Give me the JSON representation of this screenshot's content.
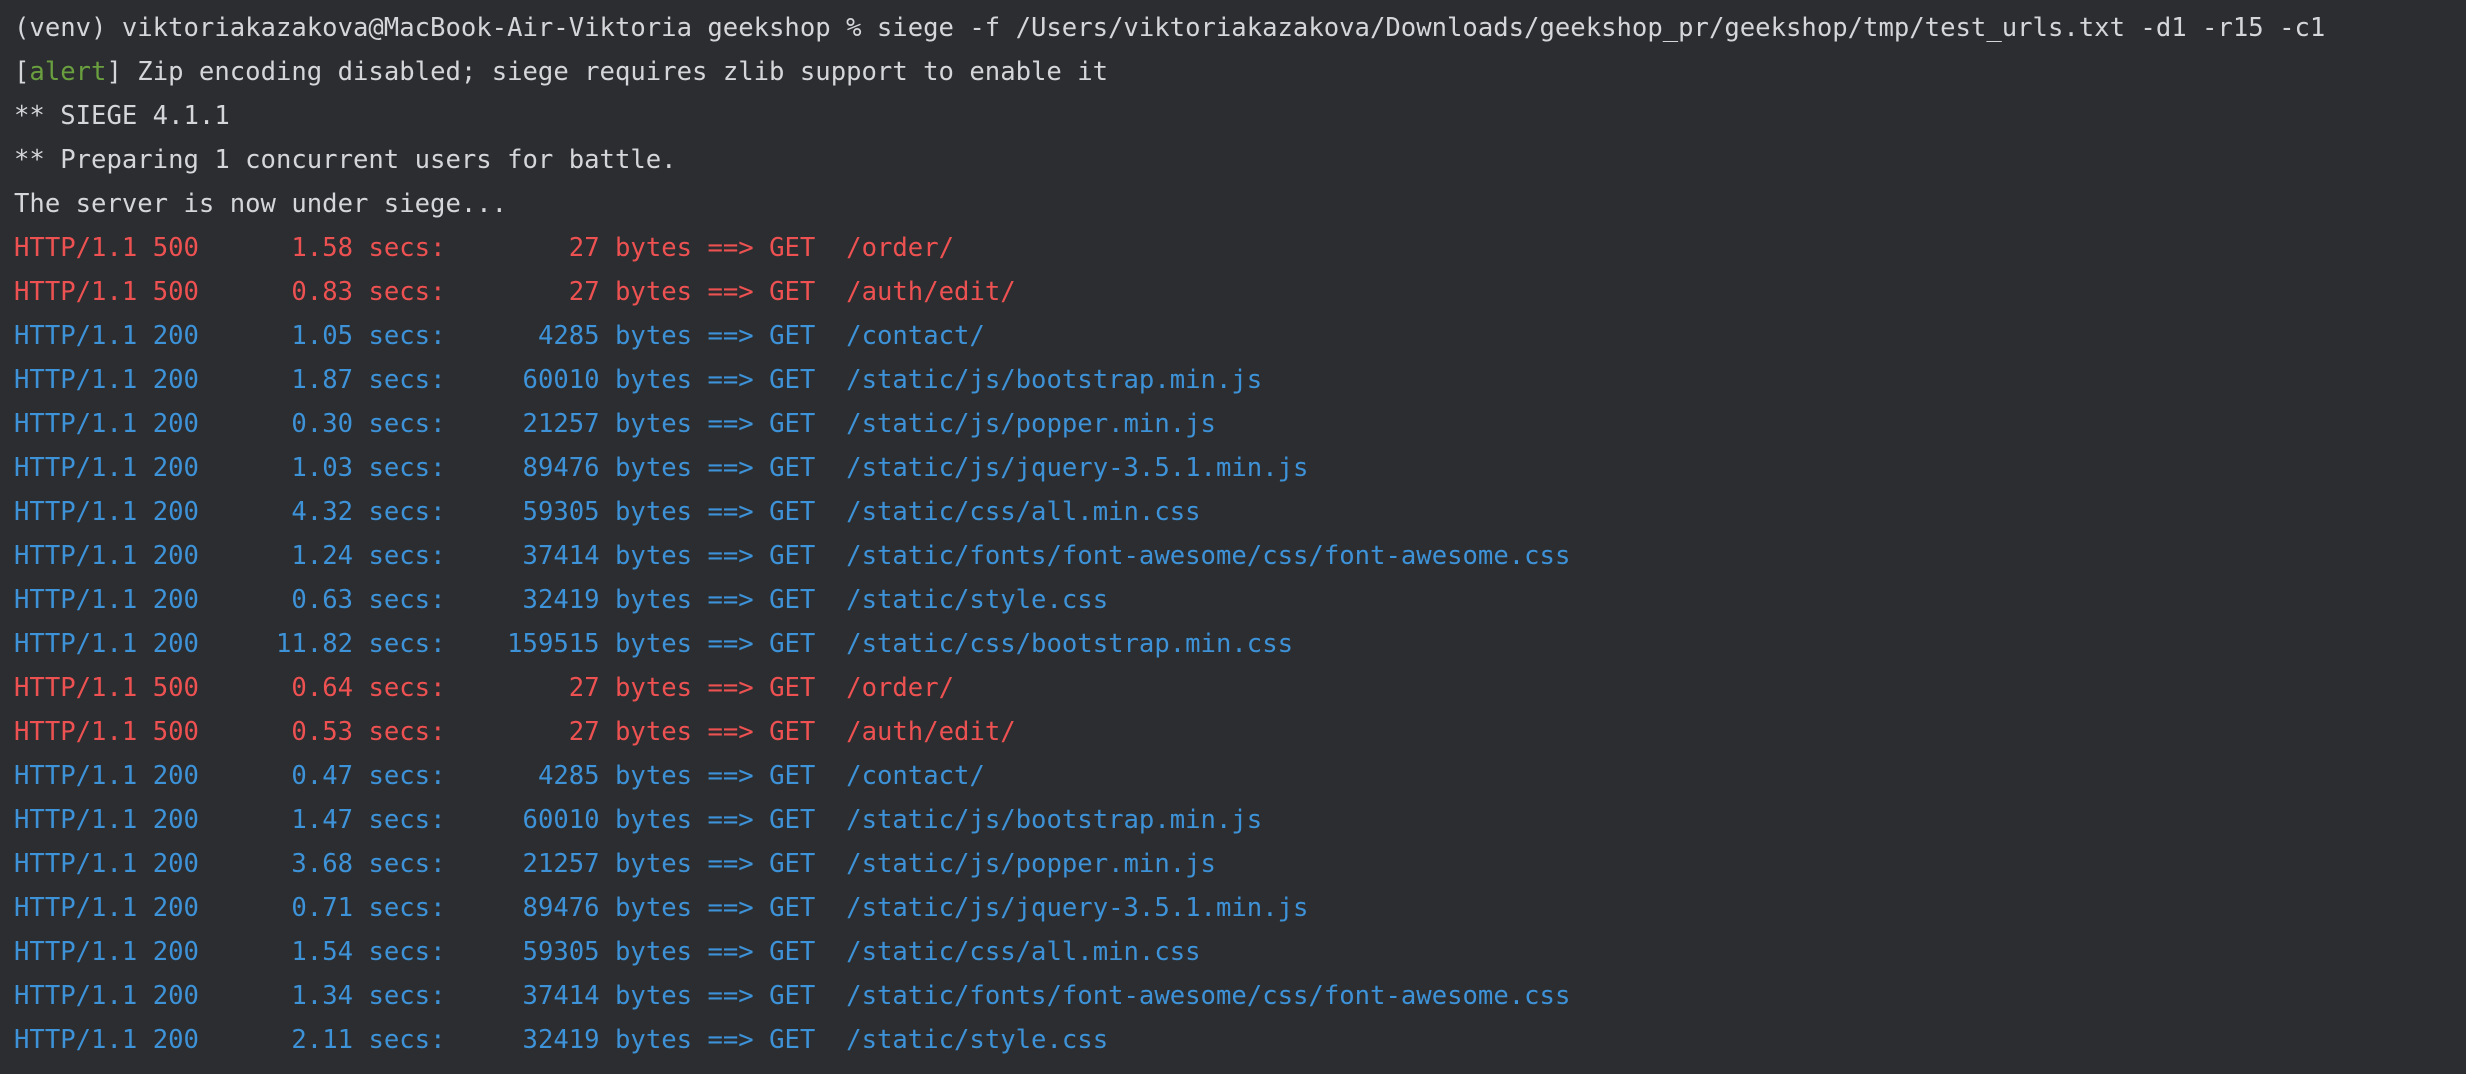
{
  "terminal": {
    "command_line": "(venv) viktoriakazakova@MacBook-Air-Viktoria geekshop % siege -f /Users/viktoriakazakova/Downloads/geekshop_pr/geekshop/tmp/test_urls.txt -d1 -r15 -c1",
    "alert": {
      "open_bracket": "[",
      "tag": "alert",
      "close_bracket": "]",
      "message": " Zip encoding disabled; siege requires zlib support to enable it"
    },
    "siege_version": "** SIEGE 4.1.1",
    "preparing": "** Preparing 1 concurrent users for battle.",
    "under_siege": "The server is now under siege...",
    "colors": {
      "error": "#ee5151",
      "success": "#3d92d8",
      "alert_tag": "#6a9f3f",
      "text": "#d4d6da",
      "background": "#2b2d30"
    },
    "requests": [
      {
        "protocol": "HTTP/1.1",
        "status": "500",
        "secs": "1.58",
        "bytes": "27",
        "method": "GET",
        "path": "/order/"
      },
      {
        "protocol": "HTTP/1.1",
        "status": "500",
        "secs": "0.83",
        "bytes": "27",
        "method": "GET",
        "path": "/auth/edit/"
      },
      {
        "protocol": "HTTP/1.1",
        "status": "200",
        "secs": "1.05",
        "bytes": "4285",
        "method": "GET",
        "path": "/contact/"
      },
      {
        "protocol": "HTTP/1.1",
        "status": "200",
        "secs": "1.87",
        "bytes": "60010",
        "method": "GET",
        "path": "/static/js/bootstrap.min.js"
      },
      {
        "protocol": "HTTP/1.1",
        "status": "200",
        "secs": "0.30",
        "bytes": "21257",
        "method": "GET",
        "path": "/static/js/popper.min.js"
      },
      {
        "protocol": "HTTP/1.1",
        "status": "200",
        "secs": "1.03",
        "bytes": "89476",
        "method": "GET",
        "path": "/static/js/jquery-3.5.1.min.js"
      },
      {
        "protocol": "HTTP/1.1",
        "status": "200",
        "secs": "4.32",
        "bytes": "59305",
        "method": "GET",
        "path": "/static/css/all.min.css"
      },
      {
        "protocol": "HTTP/1.1",
        "status": "200",
        "secs": "1.24",
        "bytes": "37414",
        "method": "GET",
        "path": "/static/fonts/font-awesome/css/font-awesome.css"
      },
      {
        "protocol": "HTTP/1.1",
        "status": "200",
        "secs": "0.63",
        "bytes": "32419",
        "method": "GET",
        "path": "/static/style.css"
      },
      {
        "protocol": "HTTP/1.1",
        "status": "200",
        "secs": "11.82",
        "bytes": "159515",
        "method": "GET",
        "path": "/static/css/bootstrap.min.css"
      },
      {
        "protocol": "HTTP/1.1",
        "status": "500",
        "secs": "0.64",
        "bytes": "27",
        "method": "GET",
        "path": "/order/"
      },
      {
        "protocol": "HTTP/1.1",
        "status": "500",
        "secs": "0.53",
        "bytes": "27",
        "method": "GET",
        "path": "/auth/edit/"
      },
      {
        "protocol": "HTTP/1.1",
        "status": "200",
        "secs": "0.47",
        "bytes": "4285",
        "method": "GET",
        "path": "/contact/"
      },
      {
        "protocol": "HTTP/1.1",
        "status": "200",
        "secs": "1.47",
        "bytes": "60010",
        "method": "GET",
        "path": "/static/js/bootstrap.min.js"
      },
      {
        "protocol": "HTTP/1.1",
        "status": "200",
        "secs": "3.68",
        "bytes": "21257",
        "method": "GET",
        "path": "/static/js/popper.min.js"
      },
      {
        "protocol": "HTTP/1.1",
        "status": "200",
        "secs": "0.71",
        "bytes": "89476",
        "method": "GET",
        "path": "/static/js/jquery-3.5.1.min.js"
      },
      {
        "protocol": "HTTP/1.1",
        "status": "200",
        "secs": "1.54",
        "bytes": "59305",
        "method": "GET",
        "path": "/static/css/all.min.css"
      },
      {
        "protocol": "HTTP/1.1",
        "status": "200",
        "secs": "1.34",
        "bytes": "37414",
        "method": "GET",
        "path": "/static/fonts/font-awesome/css/font-awesome.css"
      },
      {
        "protocol": "HTTP/1.1",
        "status": "200",
        "secs": "2.11",
        "bytes": "32419",
        "method": "GET",
        "path": "/static/style.css"
      }
    ]
  }
}
